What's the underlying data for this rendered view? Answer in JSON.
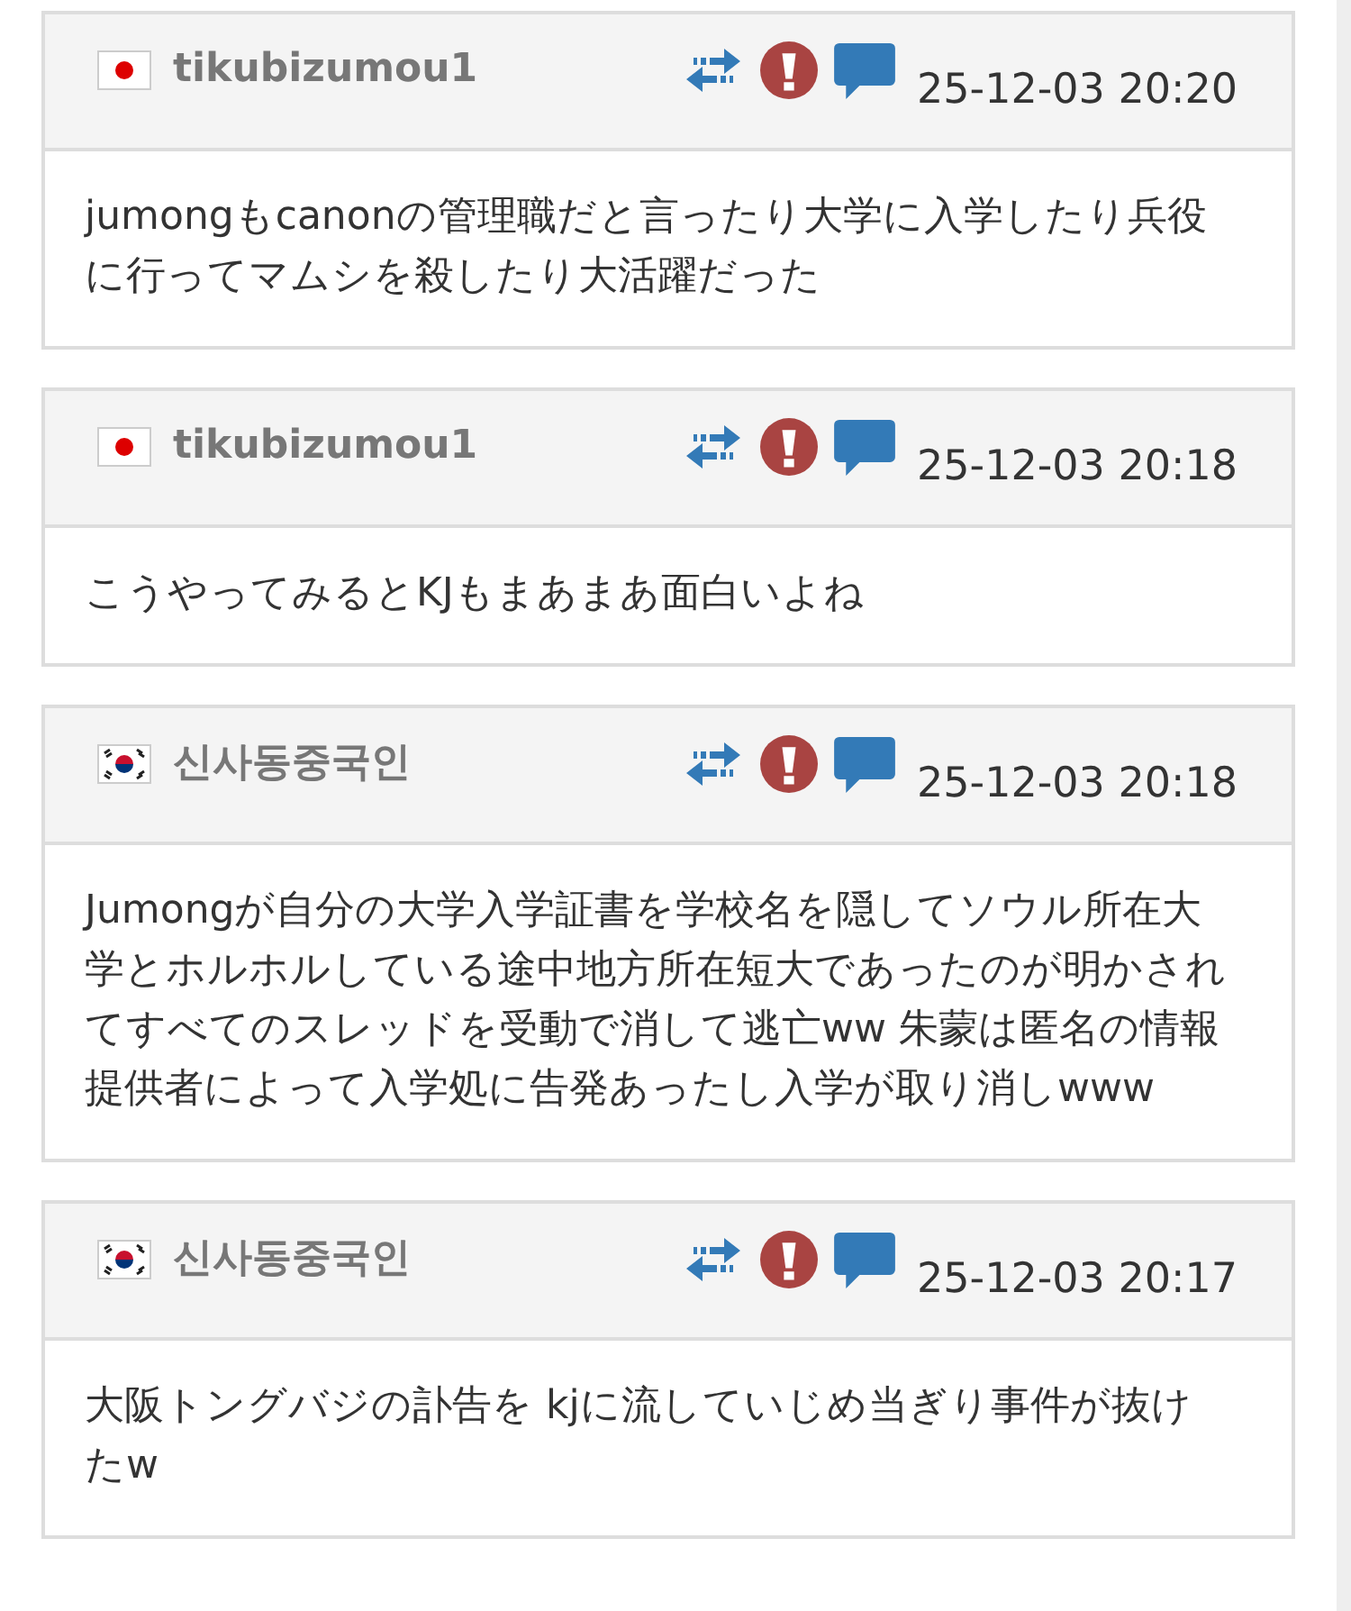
{
  "posts": [
    {
      "kind": "jp",
      "author": "tikubizumou1",
      "time": "25-12-03 20:20",
      "body": "jumongもcanonの管理職だと言ったり大学に入学したり兵役に行ってマムシを殺したり大活躍だった"
    },
    {
      "kind": "jp",
      "author": "tikubizumou1",
      "time": "25-12-03 20:18",
      "body": "こうやってみるとKJもまあまあ面白いよね"
    },
    {
      "kind": "kr",
      "author": "신사동중국인",
      "time": "25-12-03 20:18",
      "body": "Jumongが自分の大学入学証書を学校名を隠してソウル所在大学とホルホルしている途中地方所在短大であったのが明かされてすべてのスレッドを受動で消して逃亡ww 朱蒙は匿名の情報提供者によって入学処に告発あったし入学が取り消しwww"
    },
    {
      "kind": "kr",
      "author": "신사동중국인",
      "time": "25-12-03 20:17",
      "body": "大阪トングバジの訃告を kjに流していじめ当ぎり事件が抜けたw"
    }
  ]
}
